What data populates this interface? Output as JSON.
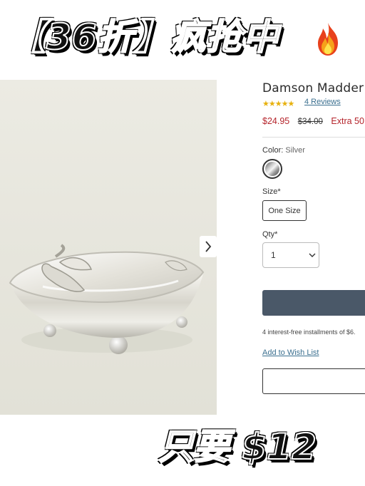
{
  "top_banner": {
    "text": "【36折】疯抢中",
    "icon": "fire-icon"
  },
  "product": {
    "title": "Damson Madder",
    "rating_stars": "★★★★★",
    "reviews_link": "4 Reviews",
    "price_sale": "$24.95",
    "price_original": "$34.00",
    "price_extra": "Extra 50",
    "color_label": "Color:",
    "color_value": "Silver",
    "size_label": "Size*",
    "size_option": "One Size",
    "qty_label": "Qty*",
    "qty_value": "1",
    "installments": "4 interest-free installments of $6.",
    "wishlist_link": "Add to Wish List"
  },
  "bottom_banner": {
    "text": "只要 $12"
  },
  "colors": {
    "sale_red": "#b5252c",
    "link_blue": "#3a6f8f",
    "star_gold": "#e7b10e",
    "add_button": "#4a5868"
  }
}
